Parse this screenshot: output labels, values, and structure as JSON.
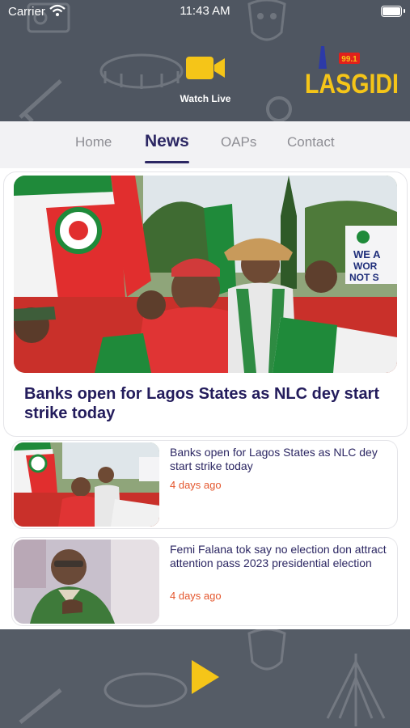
{
  "status_bar": {
    "carrier": "Carrier",
    "time": "11:43 AM"
  },
  "header": {
    "watch_live_label": "Watch Live",
    "logo_text": "LASGIDI",
    "logo_badge": "99.1",
    "icon": "video-camera-icon"
  },
  "tabs": [
    {
      "label": "Home",
      "active": false
    },
    {
      "label": "News",
      "active": true
    },
    {
      "label": "OAPs",
      "active": false
    },
    {
      "label": "Contact",
      "active": false
    }
  ],
  "featured": {
    "title": "Banks open for Lagos States as NLC dey start strike today",
    "sign_text": "WE ARE WORKERS NOT SL"
  },
  "news": [
    {
      "title": "Banks open for Lagos States as NLC dey start strike today",
      "time": "4 days ago"
    },
    {
      "title": "Femi Falana tok say no election don attract attention pass 2023 presidential election",
      "time": "4 days ago"
    }
  ],
  "player": {
    "icon": "play-icon"
  },
  "colors": {
    "accent": "#f5c518",
    "brand_navy": "#2c2763",
    "time_red": "#e4572e",
    "header_bg": "#4f5661"
  }
}
